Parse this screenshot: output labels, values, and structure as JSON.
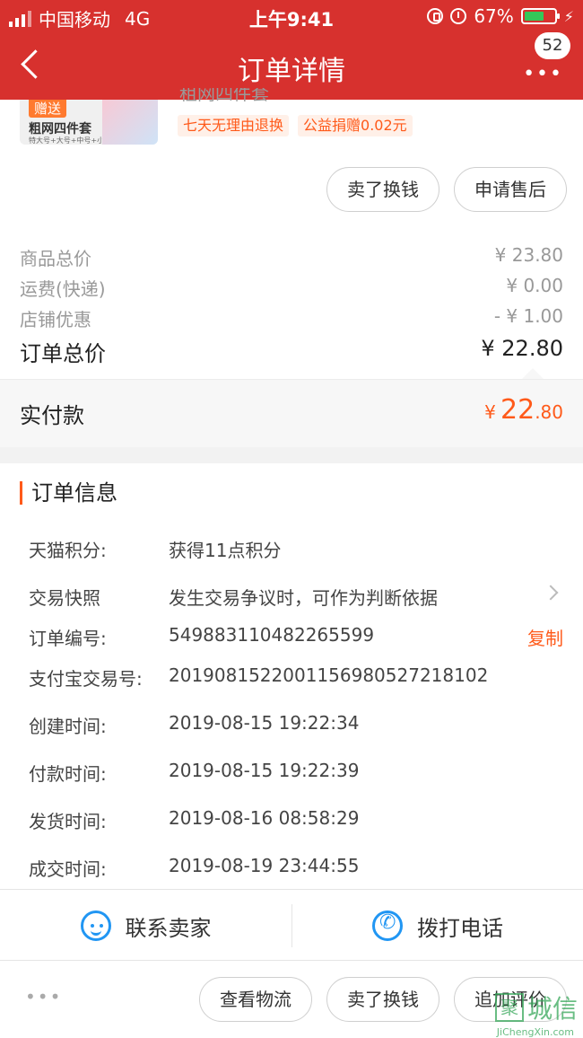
{
  "status_bar": {
    "carrier": "中国移动",
    "network": "4G",
    "time": "上午9:41",
    "battery_percent_label": "67%",
    "battery_level": 0.67
  },
  "nav": {
    "title": "订单详情",
    "badge_count": "52",
    "more_label": "•••"
  },
  "product": {
    "gift_tag": "赠送",
    "thumb_title": "粗网四件套",
    "thumb_sub": "特大号+大号+中号+小号",
    "name_partial": "租网四件套",
    "tags": [
      "七天无理由退换",
      "公益捐赠0.02元"
    ]
  },
  "item_actions": [
    "卖了换钱",
    "申请售后"
  ],
  "summary": {
    "rows": [
      {
        "label": "商品总价",
        "value": "¥ 23.80"
      },
      {
        "label": "运费(快递)",
        "value": "¥ 0.00"
      },
      {
        "label": "店铺优惠",
        "value": "- ¥ 1.00"
      }
    ],
    "total_label": "订单总价",
    "total_value": "¥ 22.80",
    "paid_label": "实付款",
    "paid_currency": "¥",
    "paid_int": "22",
    "paid_dec": ".80"
  },
  "order_info": {
    "title": "订单信息",
    "rows": [
      {
        "label": "天猫积分:",
        "value": "获得11点积分"
      },
      {
        "label": "交易快照",
        "value": "发生交易争议时，可作为判断依据"
      },
      {
        "label": "订单编号:",
        "value": "549883110482265599"
      },
      {
        "label": "支付宝交易号:",
        "value": "2019081522001156980527218102"
      },
      {
        "label": "创建时间:",
        "value": "2019-08-15 19:22:34"
      },
      {
        "label": "付款时间:",
        "value": "2019-08-15 19:22:39"
      },
      {
        "label": "发货时间:",
        "value": "2019-08-16 08:58:29"
      },
      {
        "label": "成交时间:",
        "value": "2019-08-19 23:44:55"
      }
    ],
    "copy_label": "复制"
  },
  "contact": {
    "seller_label": "联系卖家",
    "phone_label": "拨打电话"
  },
  "bottom_actions": {
    "more": "•••",
    "buttons": [
      "查看物流",
      "卖了换钱",
      "追加评价"
    ]
  },
  "watermark": {
    "box": "聚",
    "text": "城信",
    "sub": "JiChengXin.com"
  },
  "colors": {
    "header_red": "#d7312e",
    "accent_orange": "#ff5a1a",
    "icon_blue": "#2196f3"
  }
}
